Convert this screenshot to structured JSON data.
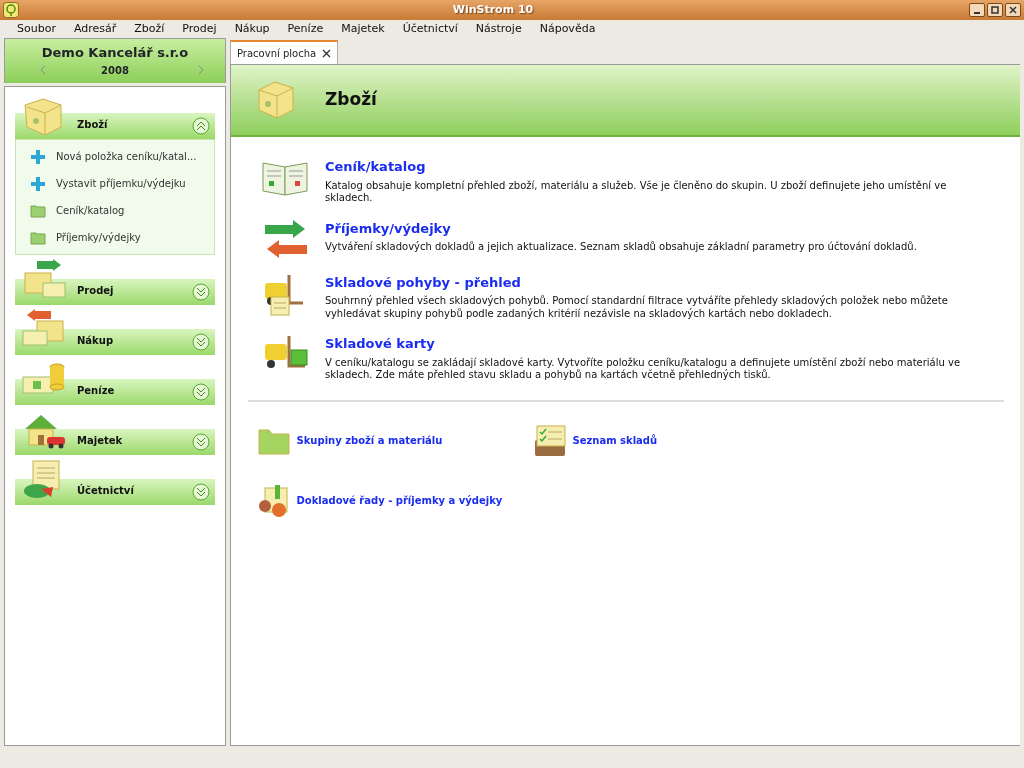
{
  "window": {
    "title": "WinStrom 10"
  },
  "menu": [
    "Soubor",
    "Adresář",
    "Zboží",
    "Prodej",
    "Nákup",
    "Peníze",
    "Majetek",
    "Účetnictví",
    "Nástroje",
    "Nápověda"
  ],
  "company": {
    "name": "Demo Kancelář s.r.o",
    "year": "2008"
  },
  "sections": [
    {
      "label": "Zboží",
      "kind": "goods",
      "expanded": true,
      "items": [
        {
          "label": "Nová položka ceníku/katal...",
          "kind": "add"
        },
        {
          "label": "Vystavit příjemku/výdejku",
          "kind": "add"
        },
        {
          "label": "Ceník/katalog",
          "kind": "folder"
        },
        {
          "label": "Příjemky/výdejky",
          "kind": "folder"
        }
      ]
    },
    {
      "label": "Prodej",
      "kind": "sale",
      "expanded": false
    },
    {
      "label": "Nákup",
      "kind": "purchase",
      "expanded": false
    },
    {
      "label": "Peníze",
      "kind": "money",
      "expanded": false
    },
    {
      "label": "Majetek",
      "kind": "property",
      "expanded": false
    },
    {
      "label": "Účetnictví",
      "kind": "accounting",
      "expanded": false
    }
  ],
  "tabs": [
    {
      "label": "Pracovní plocha",
      "selected": true
    }
  ],
  "page": {
    "title": "Zboží",
    "entries": [
      {
        "kind": "book",
        "title": "Ceník/katalog",
        "text": "Katalog obsahuje kompletní přehled zboží, materiálu a služeb. Vše je členěno do skupin. U zboží definujete jeho umístění ve skladech."
      },
      {
        "kind": "arrows",
        "title": "Příjemky/výdejky",
        "text": "Vytváření skladových dokladů a jejich aktualizace. Seznam skladů obsahuje základní parametry pro účtování dokladů."
      },
      {
        "kind": "forklift-doc",
        "title": "Skladové pohyby - přehled",
        "text": "Souhrnný přehled všech skladových pohybů. Pomocí standardní filtrace vytváříte přehledy skladových položek nebo můžete vyhledávat skupiny pohybů podle zadaných kritérií nezávisle na skladových kartách nebo dokladech."
      },
      {
        "kind": "forklift-box",
        "title": "Skladové karty",
        "text": "V ceníku/katalogu se zakládají skladové karty. Vytvoříte položku ceníku/katalogu a definujete umístění zboží nebo materiálu ve skladech. Zde máte přehled stavu skladu a pohybů na kartách včetně přehledných tisků."
      }
    ],
    "links": [
      {
        "kind": "folder",
        "label": "Skupiny zboží a materiálu"
      },
      {
        "kind": "list",
        "label": "Seznam skladů"
      },
      {
        "kind": "numbers",
        "label": "Dokladové řady - příjemky a výdejky"
      }
    ]
  }
}
